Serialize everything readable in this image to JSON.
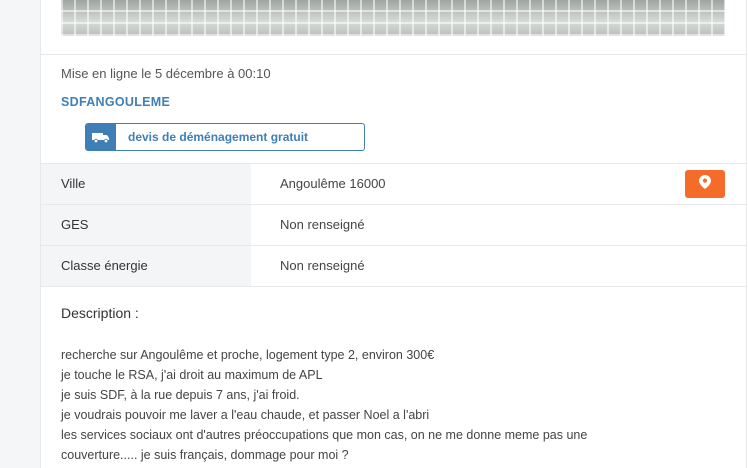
{
  "listing": {
    "posted": "Mise en ligne le 5 décembre à 00:10",
    "seller": "SDFANGOULEME",
    "quote_button": {
      "icon": "truck-icon",
      "label": "devis de déménagement gratuit"
    },
    "attributes": [
      {
        "key": "Ville",
        "value": "Angoulême 16000"
      },
      {
        "key": "GES",
        "value": "Non renseigné"
      },
      {
        "key": "Classe énergie",
        "value": "Non renseigné"
      }
    ],
    "map_button": {
      "icon": "map-pin-icon",
      "color": "#f56b2a"
    },
    "description": {
      "title": "Description :",
      "lines": [
        "recherche sur Angoulême et proche, logement type 2, environ 300€",
        "je touche le RSA, j'ai droit au maximum de APL",
        "je suis SDF, à la rue depuis 7 ans, j'ai froid.",
        "je voudrais pouvoir me laver a l'eau chaude, et passer Noel a l'abri",
        "les services sociaux ont d'autres préoccupations que mon cas, on ne me donne meme pas une",
        "couverture..... je suis français, dommage pour moi ?"
      ]
    }
  },
  "colors": {
    "accent": "#3f7fb6",
    "map_button": "#f56b2a",
    "row_key_bg": "#f3f5f7"
  }
}
